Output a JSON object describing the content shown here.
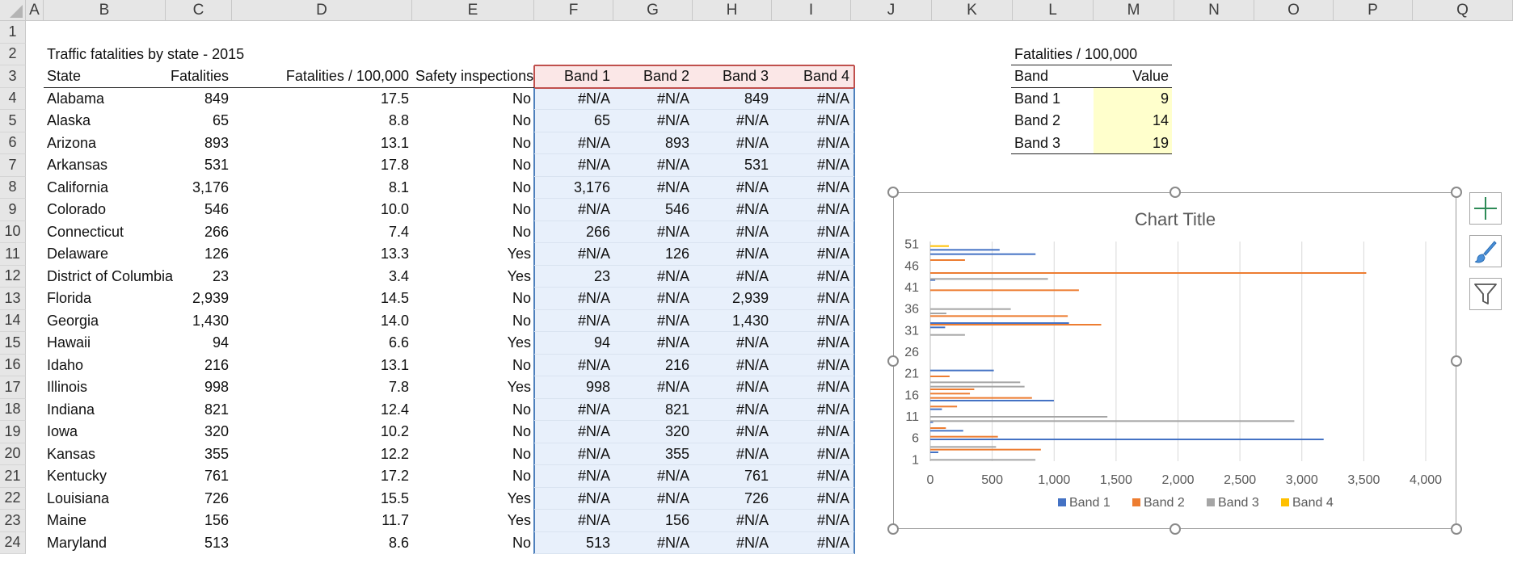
{
  "columns": [
    "A",
    "B",
    "C",
    "D",
    "E",
    "F",
    "G",
    "H",
    "I",
    "J",
    "K",
    "L",
    "M",
    "N",
    "O",
    "P",
    "Q"
  ],
  "rows": [
    "1",
    "2",
    "3",
    "4",
    "5",
    "6",
    "7",
    "8",
    "9",
    "10",
    "11",
    "12",
    "13",
    "14",
    "15",
    "16",
    "17",
    "18",
    "19",
    "20",
    "21",
    "22",
    "23",
    "24"
  ],
  "table": {
    "title": "Traffic fatalities by state - 2015",
    "headers": [
      "State",
      "Fatalities",
      "Fatalities / 100,000",
      "Safety inspections",
      "Band 1",
      "Band 2",
      "Band 3",
      "Band 4"
    ],
    "rows": [
      [
        "Alabama",
        "849",
        "17.5",
        "No",
        "#N/A",
        "#N/A",
        "849",
        "#N/A"
      ],
      [
        "Alaska",
        "65",
        "8.8",
        "No",
        "65",
        "#N/A",
        "#N/A",
        "#N/A"
      ],
      [
        "Arizona",
        "893",
        "13.1",
        "No",
        "#N/A",
        "893",
        "#N/A",
        "#N/A"
      ],
      [
        "Arkansas",
        "531",
        "17.8",
        "No",
        "#N/A",
        "#N/A",
        "531",
        "#N/A"
      ],
      [
        "California",
        "3,176",
        "8.1",
        "No",
        "3,176",
        "#N/A",
        "#N/A",
        "#N/A"
      ],
      [
        "Colorado",
        "546",
        "10.0",
        "No",
        "#N/A",
        "546",
        "#N/A",
        "#N/A"
      ],
      [
        "Connecticut",
        "266",
        "7.4",
        "No",
        "266",
        "#N/A",
        "#N/A",
        "#N/A"
      ],
      [
        "Delaware",
        "126",
        "13.3",
        "Yes",
        "#N/A",
        "126",
        "#N/A",
        "#N/A"
      ],
      [
        "District of Columbia",
        "23",
        "3.4",
        "Yes",
        "23",
        "#N/A",
        "#N/A",
        "#N/A"
      ],
      [
        "Florida",
        "2,939",
        "14.5",
        "No",
        "#N/A",
        "#N/A",
        "2,939",
        "#N/A"
      ],
      [
        "Georgia",
        "1,430",
        "14.0",
        "No",
        "#N/A",
        "#N/A",
        "1,430",
        "#N/A"
      ],
      [
        "Hawaii",
        "94",
        "6.6",
        "Yes",
        "94",
        "#N/A",
        "#N/A",
        "#N/A"
      ],
      [
        "Idaho",
        "216",
        "13.1",
        "No",
        "#N/A",
        "216",
        "#N/A",
        "#N/A"
      ],
      [
        "Illinois",
        "998",
        "7.8",
        "Yes",
        "998",
        "#N/A",
        "#N/A",
        "#N/A"
      ],
      [
        "Indiana",
        "821",
        "12.4",
        "No",
        "#N/A",
        "821",
        "#N/A",
        "#N/A"
      ],
      [
        "Iowa",
        "320",
        "10.2",
        "No",
        "#N/A",
        "320",
        "#N/A",
        "#N/A"
      ],
      [
        "Kansas",
        "355",
        "12.2",
        "No",
        "#N/A",
        "355",
        "#N/A",
        "#N/A"
      ],
      [
        "Kentucky",
        "761",
        "17.2",
        "No",
        "#N/A",
        "#N/A",
        "761",
        "#N/A"
      ],
      [
        "Louisiana",
        "726",
        "15.5",
        "Yes",
        "#N/A",
        "#N/A",
        "726",
        "#N/A"
      ],
      [
        "Maine",
        "156",
        "11.7",
        "Yes",
        "#N/A",
        "156",
        "#N/A",
        "#N/A"
      ],
      [
        "Maryland",
        "513",
        "8.6",
        "No",
        "513",
        "#N/A",
        "#N/A",
        "#N/A"
      ]
    ]
  },
  "band_table": {
    "title": "Fatalities / 100,000",
    "headers": [
      "Band",
      "Value"
    ],
    "rows": [
      [
        "Band 1",
        "9"
      ],
      [
        "Band 2",
        "14"
      ],
      [
        "Band 3",
        "19"
      ]
    ]
  },
  "side_buttons": [
    "chart-elements-icon",
    "chart-styles-icon",
    "chart-filters-icon"
  ],
  "chart_data": {
    "type": "bar",
    "orientation": "horizontal",
    "title": "Chart Title",
    "y_tick_labels": [
      "1",
      "6",
      "11",
      "16",
      "21",
      "26",
      "31",
      "36",
      "41",
      "46",
      "51"
    ],
    "x_tick_labels": [
      "0",
      "500",
      "1,000",
      "1,500",
      "2,000",
      "2,500",
      "3,000",
      "3,500",
      "4,000"
    ],
    "xlim": [
      0,
      4000
    ],
    "grid": true,
    "legend": "bottom",
    "colors": {
      "Band 1": "#4472c4",
      "Band 2": "#ed7d31",
      "Band 3": "#a5a5a5",
      "Band 4": "#ffc000"
    },
    "series": [
      {
        "name": "Band 1",
        "values": [
          null,
          65,
          null,
          null,
          3176,
          null,
          266,
          null,
          23,
          null,
          null,
          94,
          null,
          998,
          null,
          null,
          null,
          null,
          null,
          null,
          513,
          null,
          null,
          null,
          null,
          null,
          null,
          null,
          null,
          null,
          120,
          1120,
          null,
          null,
          null,
          null,
          null,
          null,
          null,
          null,
          null,
          40,
          null,
          null,
          null,
          null,
          null,
          850,
          560,
          null,
          null
        ]
      },
      {
        "name": "Band 2",
        "values": [
          null,
          null,
          893,
          null,
          null,
          546,
          null,
          126,
          null,
          null,
          null,
          null,
          216,
          null,
          821,
          320,
          355,
          null,
          null,
          156,
          null,
          null,
          null,
          null,
          null,
          null,
          null,
          null,
          null,
          null,
          null,
          1380,
          null,
          1110,
          null,
          null,
          null,
          null,
          null,
          1200,
          null,
          null,
          null,
          3520,
          null,
          null,
          280,
          null,
          null,
          null,
          null
        ]
      },
      {
        "name": "Band 3",
        "values": [
          849,
          null,
          null,
          531,
          null,
          null,
          null,
          null,
          null,
          2939,
          1430,
          null,
          null,
          null,
          null,
          null,
          null,
          761,
          726,
          null,
          null,
          null,
          null,
          null,
          null,
          null,
          null,
          null,
          null,
          280,
          null,
          null,
          null,
          null,
          130,
          650,
          null,
          null,
          null,
          null,
          null,
          null,
          950,
          null,
          null,
          null,
          null,
          null,
          null,
          null,
          null
        ]
      },
      {
        "name": "Band 4",
        "values": [
          null,
          null,
          null,
          null,
          null,
          null,
          null,
          null,
          null,
          null,
          null,
          null,
          null,
          null,
          null,
          null,
          null,
          null,
          null,
          null,
          null,
          null,
          null,
          null,
          null,
          null,
          null,
          null,
          null,
          null,
          null,
          null,
          null,
          null,
          null,
          null,
          null,
          null,
          null,
          null,
          null,
          null,
          null,
          null,
          null,
          null,
          null,
          null,
          null,
          null,
          150
        ]
      }
    ]
  }
}
